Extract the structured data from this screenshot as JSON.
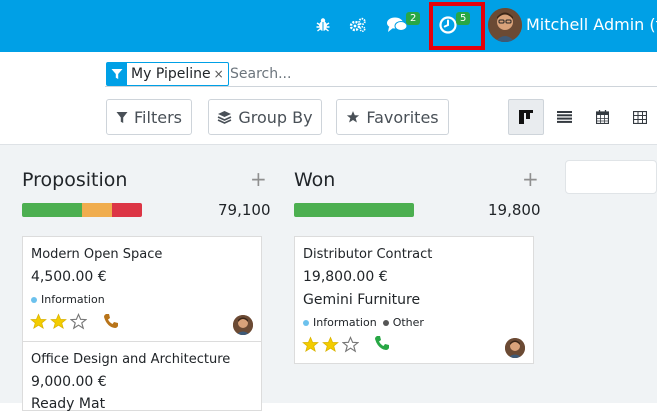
{
  "topbar": {
    "bug_icon": "bug-icon",
    "debug_icon": "cogs-icon",
    "chat_badge": "2",
    "activity_badge": "5",
    "user_name": "Mitchell Admin (fl",
    "colors": {
      "bar": "#00a0e6",
      "badge": "#28a745",
      "highlight": "#e4000a"
    }
  },
  "search": {
    "facet_label": "My Pipeline",
    "facet_remove": "×",
    "placeholder": "Search..."
  },
  "toolbar": {
    "filters_label": "Filters",
    "groupby_label": "Group By",
    "favorites_label": "Favorites",
    "views": [
      "kanban-view-icon",
      "list-view-icon",
      "calendar-view-icon",
      "pivot-view-icon"
    ]
  },
  "columns": [
    {
      "title": "Proposition",
      "plus": "+",
      "total": "79,100",
      "progress": [
        {
          "fraction": 0.5,
          "color": "#4caf50"
        },
        {
          "fraction": 0.25,
          "color": "#f0ad4e"
        },
        {
          "fraction": 0.25,
          "color": "#dc3545"
        }
      ],
      "cards": [
        {
          "title": "Modern Open Space",
          "amount": "4,500.00 €",
          "tags": [
            {
              "label": "Information",
              "color": "#6cc1ed"
            }
          ],
          "stars": 2,
          "phone_color": "#b8741a"
        },
        {
          "title": "Office Design and Architecture",
          "amount": "9,000.00 €",
          "company": "Ready Mat"
        }
      ]
    },
    {
      "title": "Won",
      "plus": "+",
      "total": "19,800",
      "progress": [
        {
          "fraction": 1.0,
          "color": "#4caf50"
        }
      ],
      "cards": [
        {
          "title": "Distributor Contract",
          "amount": "19,800.00 €",
          "company": "Gemini Furniture",
          "tags": [
            {
              "label": "Information",
              "color": "#6cc1ed"
            },
            {
              "label": "Other",
              "color": "#555555"
            }
          ],
          "stars": 2,
          "phone_color": "#28a745"
        }
      ]
    }
  ]
}
